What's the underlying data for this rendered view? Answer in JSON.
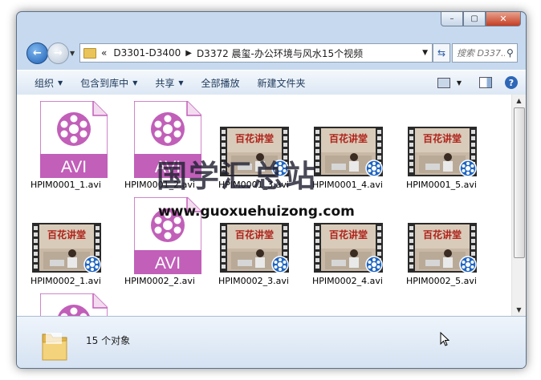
{
  "window": {
    "caption": {
      "minimize": "–",
      "maximize": "▢",
      "close": "✕"
    }
  },
  "address": {
    "overflow": "«",
    "crumbs": [
      "D3301-D3400",
      "D3372 晨玺-办公环境与风水15个视频"
    ],
    "search_placeholder": "搜索 D337..."
  },
  "toolbar": {
    "items": [
      "组织",
      "包含到库中",
      "共享",
      "全部播放",
      "新建文件夹"
    ]
  },
  "files": [
    {
      "name": "HPIM0001_1.avi",
      "kind": "avi"
    },
    {
      "name": "HPIM0001_2.avi",
      "kind": "avi"
    },
    {
      "name": "HPIM0001_3.avi",
      "kind": "video"
    },
    {
      "name": "HPIM0001_4.avi",
      "kind": "video"
    },
    {
      "name": "HPIM0001_5.avi",
      "kind": "video"
    },
    {
      "name": "HPIM0002_1.avi",
      "kind": "video"
    },
    {
      "name": "HPIM0002_2.avi",
      "kind": "avi"
    },
    {
      "name": "HPIM0002_3.avi",
      "kind": "video"
    },
    {
      "name": "HPIM0002_4.avi",
      "kind": "video"
    },
    {
      "name": "HPIM0002_5.avi",
      "kind": "video"
    },
    {
      "name": "",
      "kind": "avi"
    }
  ],
  "avi_badge": "AVI",
  "thumb_banner": "百花讲堂",
  "status": {
    "count": "15 个对象"
  },
  "watermark": {
    "line1": "国学汇总站",
    "line2": "www.guoxuehuizong.com"
  },
  "colors": {
    "avi_purple": "#c15fb9",
    "window_frame": "#c7d9ee",
    "accent_blue": "#1d5fb5"
  }
}
